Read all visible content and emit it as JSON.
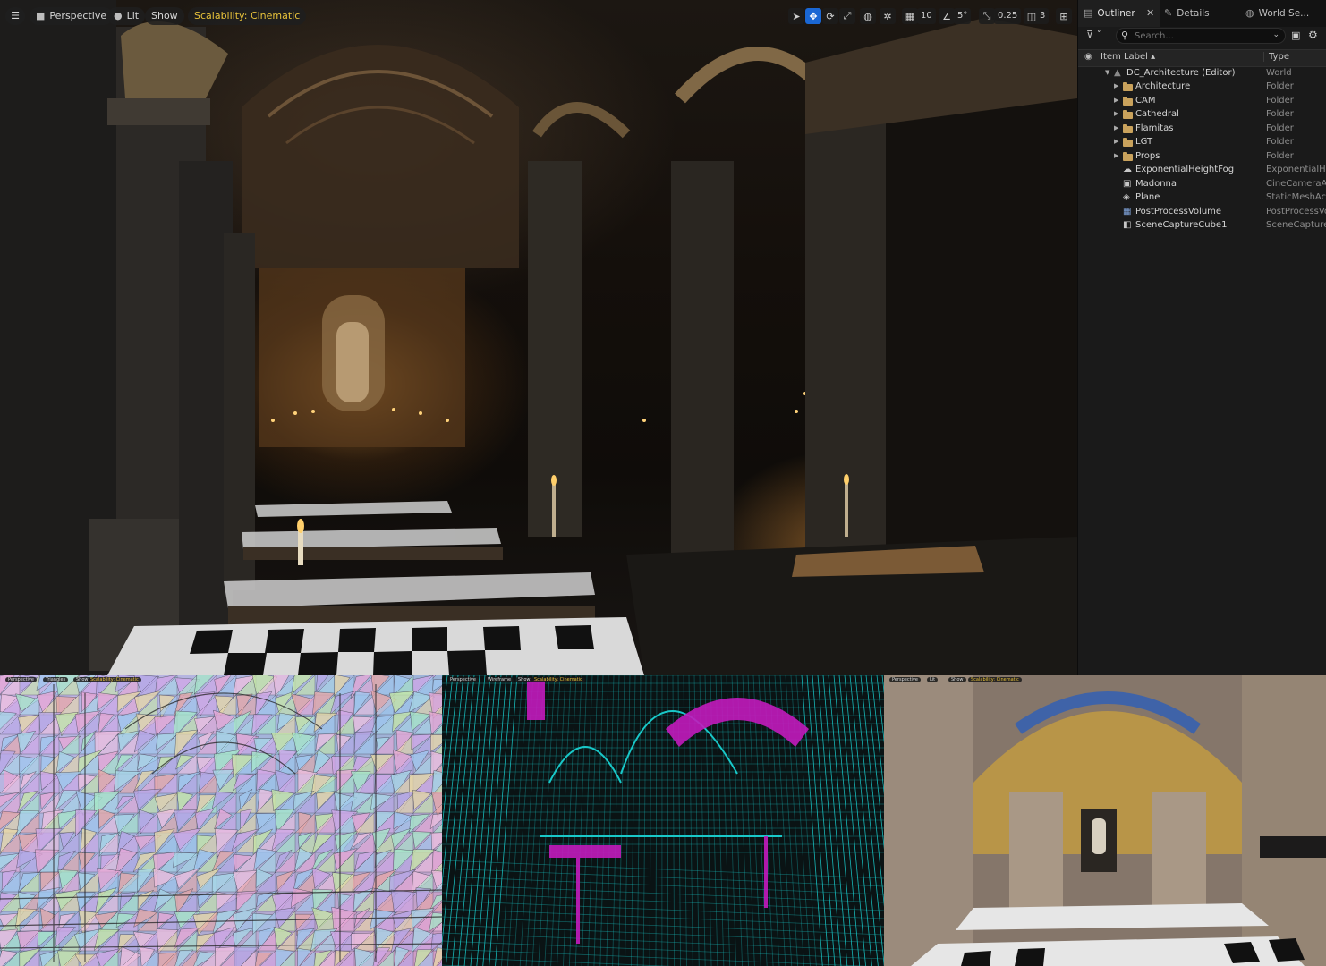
{
  "viewport": {
    "menu_icon": "hamburger-icon",
    "perspective_label": "Perspective",
    "view_mode_label": "Lit",
    "show_label": "Show",
    "scalability_label": "Scalability: Cinematic",
    "toolbar": {
      "grid_snap_value": "10",
      "rotation_snap_value": "5°",
      "scale_snap_value": "0.25",
      "camera_speed_value": "3"
    }
  },
  "outliner": {
    "tabs": [
      {
        "label": "Outliner",
        "icon": "outliner-icon"
      },
      {
        "label": "Details",
        "icon": "pencil-icon"
      },
      {
        "label": "World Se...",
        "icon": "globe-icon"
      }
    ],
    "close_glyph": "✕",
    "search_placeholder": "Search...",
    "columns": {
      "label": "Item Label",
      "type": "Type"
    },
    "items": [
      {
        "name": "DC_Architecture (Editor)",
        "type": "World",
        "kind": "world"
      },
      {
        "name": "Architecture",
        "type": "Folder",
        "kind": "folder"
      },
      {
        "name": "CAM",
        "type": "Folder",
        "kind": "folder"
      },
      {
        "name": "Cathedral",
        "type": "Folder",
        "kind": "folder"
      },
      {
        "name": "Flamitas",
        "type": "Folder",
        "kind": "folder"
      },
      {
        "name": "LGT",
        "type": "Folder",
        "kind": "folder"
      },
      {
        "name": "Props",
        "type": "Folder",
        "kind": "folder"
      },
      {
        "name": "ExponentialHeightFog",
        "type": "ExponentialHeightFog",
        "kind": "fog"
      },
      {
        "name": "Madonna",
        "type": "CineCameraActor",
        "kind": "camera"
      },
      {
        "name": "Plane",
        "type": "StaticMeshActor",
        "kind": "mesh"
      },
      {
        "name": "PostProcessVolume",
        "type": "PostProcessVolume",
        "kind": "volume"
      },
      {
        "name": "SceneCaptureCube1",
        "type": "SceneCaptureCube",
        "kind": "capture"
      }
    ]
  },
  "mini_viewports": {
    "triangles": {
      "perspective": "Perspective",
      "mode": "Triangles",
      "show": "Show",
      "scal": "Scalability: Cinematic"
    },
    "wireframe": {
      "perspective": "Perspective",
      "mode": "Wireframe",
      "show": "Show",
      "scal": "Scalability: Cinematic"
    },
    "textured": {
      "perspective": "Perspective",
      "mode": "Lit",
      "show": "Show",
      "scal": "Scalability: Cinematic"
    }
  },
  "colors": {
    "accent": "#1a67d4",
    "scalability": "#e8c23a",
    "folder": "#c9a25c",
    "wire_cyan": "#19c8c8",
    "wire_magenta": "#c21bbd"
  }
}
